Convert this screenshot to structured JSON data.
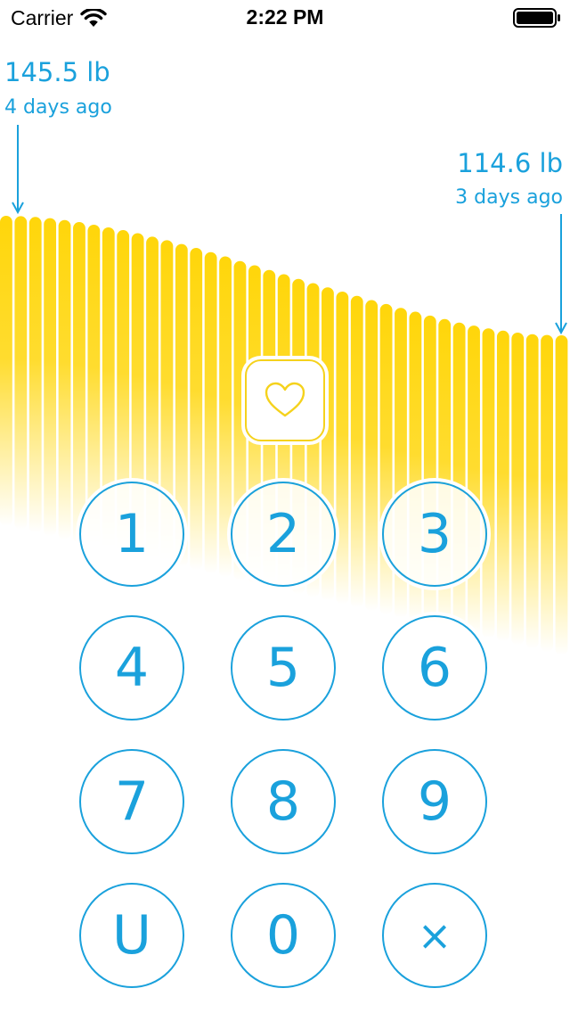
{
  "status_bar": {
    "carrier": "Carrier",
    "time": "2:22 PM"
  },
  "chart_data": {
    "type": "bar",
    "bar_count": 39,
    "start": {
      "value": "145.5 lb",
      "time": "4 days ago"
    },
    "end": {
      "value": "114.6 lb",
      "time": "3 days ago"
    },
    "values_lb": [
      145.5,
      145.4,
      145.2,
      144.9,
      144.4,
      143.9,
      143.2,
      142.5,
      141.8,
      141.0,
      140.1,
      139.2,
      138.2,
      137.2,
      136.1,
      135.0,
      133.8,
      132.7,
      131.5,
      130.4,
      129.2,
      128.1,
      127.0,
      125.9,
      124.8,
      123.7,
      122.7,
      121.7,
      120.7,
      119.7,
      118.8,
      117.9,
      117.1,
      116.4,
      115.8,
      115.3,
      114.9,
      114.7,
      114.6
    ],
    "bar_color": "#ffd60a",
    "label_color": "#1aa1dc"
  },
  "health_button": {
    "icon": "heart-icon",
    "color": "#f5d21c"
  },
  "keypad": {
    "keys": [
      "1",
      "2",
      "3",
      "4",
      "5",
      "6",
      "7",
      "8",
      "9",
      "U",
      "0",
      "×"
    ],
    "accent_color": "#1aa1dc"
  }
}
